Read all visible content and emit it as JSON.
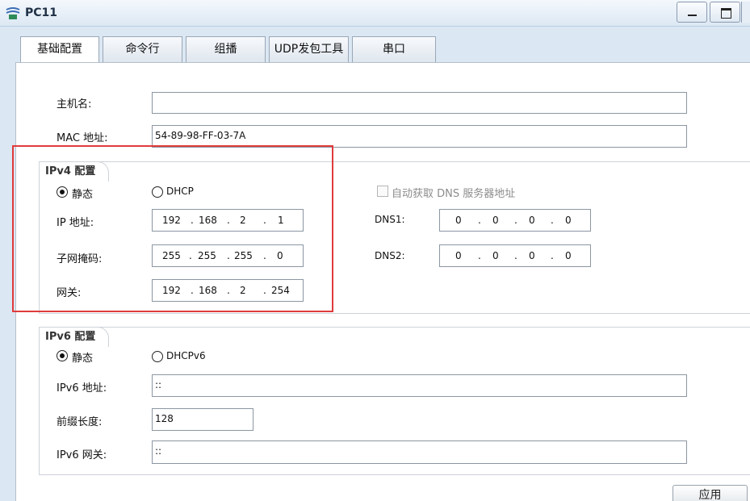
{
  "window": {
    "title": "PC11"
  },
  "tabs": [
    "基础配置",
    "命令行",
    "组播",
    "UDP发包工具",
    "串口"
  ],
  "host": {
    "label": "主机名:",
    "value": ""
  },
  "mac": {
    "label": "MAC 地址:",
    "value": "54-89-98-FF-03-7A"
  },
  "ipv4": {
    "group_title": "IPv4 配置",
    "static_label": "静态",
    "dhcp_label": "DHCP",
    "static_selected": true,
    "auto_dns_label": "自动获取 DNS 服务器地址",
    "ip_label": "IP 地址:",
    "ip": [
      "192",
      "168",
      "2",
      "1"
    ],
    "mask_label": "子网掩码:",
    "mask": [
      "255",
      "255",
      "255",
      "0"
    ],
    "gateway_label": "网关:",
    "gateway": [
      "192",
      "168",
      "2",
      "254"
    ],
    "dns1_label": "DNS1:",
    "dns1": [
      "0",
      "0",
      "0",
      "0"
    ],
    "dns2_label": "DNS2:",
    "dns2": [
      "0",
      "0",
      "0",
      "0"
    ]
  },
  "ipv6": {
    "group_title": "IPv6 配置",
    "static_label": "静态",
    "dhcp_label": "DHCPv6",
    "static_selected": true,
    "address_label": "IPv6 地址:",
    "address": "::",
    "prefix_label": "前缀长度:",
    "prefix": "128",
    "gateway_label": "IPv6 网关:",
    "gateway": "::"
  },
  "apply_label": "应用",
  "accent": {
    "highlight": "#e03b3b"
  }
}
